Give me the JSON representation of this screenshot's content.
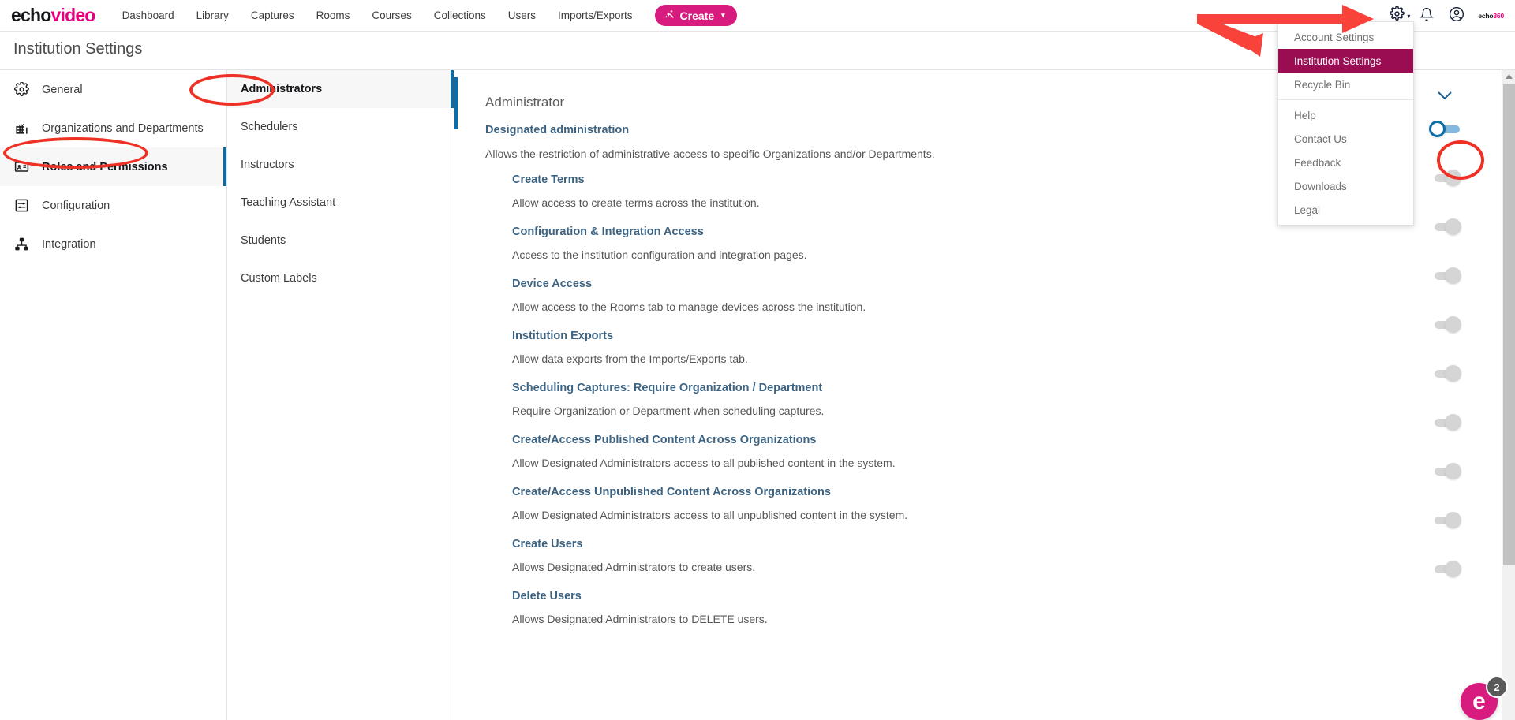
{
  "topnav": {
    "brand": {
      "part1": "echo",
      "part2": "video"
    },
    "links": [
      {
        "label": "Dashboard"
      },
      {
        "label": "Library"
      },
      {
        "label": "Captures"
      },
      {
        "label": "Rooms"
      },
      {
        "label": "Courses"
      },
      {
        "label": "Collections"
      },
      {
        "label": "Users"
      },
      {
        "label": "Imports/Exports"
      }
    ],
    "create_label": "Create",
    "create_caret": "▾",
    "wand_icon": "✨",
    "gear_caret": "▾",
    "logo_right": {
      "part1": "echo",
      "part2": "360"
    }
  },
  "settings_menu": {
    "items": [
      {
        "label": "Account Settings",
        "selected": false,
        "separator_after": false
      },
      {
        "label": "Institution Settings",
        "selected": true,
        "separator_after": false
      },
      {
        "label": "Recycle Bin",
        "selected": false,
        "separator_after": true
      },
      {
        "label": "Help",
        "selected": false,
        "separator_after": false
      },
      {
        "label": "Contact Us",
        "selected": false,
        "separator_after": false
      },
      {
        "label": "Feedback",
        "selected": false,
        "separator_after": false
      },
      {
        "label": "Downloads",
        "selected": false,
        "separator_after": false
      },
      {
        "label": "Legal",
        "selected": false,
        "separator_after": false
      }
    ]
  },
  "page": {
    "title": "Institution Settings"
  },
  "sidebar": {
    "items": [
      {
        "label": "General",
        "icon": "gear-icon",
        "active": false
      },
      {
        "label": "Organizations and Departments",
        "icon": "building-icon",
        "active": false
      },
      {
        "label": "Roles and Permissions",
        "icon": "id-card-icon",
        "active": true
      },
      {
        "label": "Configuration",
        "icon": "sliders-icon",
        "active": false
      },
      {
        "label": "Integration",
        "icon": "sitemap-icon",
        "active": false
      }
    ]
  },
  "subnav": {
    "items": [
      {
        "label": "Administrators",
        "active": true
      },
      {
        "label": "Schedulers",
        "active": false
      },
      {
        "label": "Instructors",
        "active": false
      },
      {
        "label": "Teaching Assistant",
        "active": false
      },
      {
        "label": "Students",
        "active": false
      },
      {
        "label": "Custom Labels",
        "active": false
      }
    ]
  },
  "main": {
    "heading": "Administrator",
    "top_permission": {
      "title": "Designated administration",
      "description": "Allows the restriction of administrative access to specific Organizations and/or Departments.",
      "toggle": "on"
    },
    "collapse_chevron": "⌄",
    "permissions": [
      {
        "title": "Create Terms",
        "description": "Allow access to create terms across the institution.",
        "toggle": "off"
      },
      {
        "title": "Configuration & Integration Access",
        "description": "Access to the institution configuration and integration pages.",
        "toggle": "off"
      },
      {
        "title": "Device Access",
        "description": "Allow access to the Rooms tab to manage devices across the institution.",
        "toggle": "off"
      },
      {
        "title": "Institution Exports",
        "description": "Allow data exports from the Imports/Exports tab.",
        "toggle": "off"
      },
      {
        "title": "Scheduling Captures: Require Organization / Department",
        "description": "Require Organization or Department when scheduling captures.",
        "toggle": "off"
      },
      {
        "title": "Create/Access Published Content Across Organizations",
        "description": "Allow Designated Administrators access to all published content in the system.",
        "toggle": "off"
      },
      {
        "title": "Create/Access Unpublished Content Across Organizations",
        "description": "Allow Designated Administrators access to all unpublished content in the system.",
        "toggle": "off"
      },
      {
        "title": "Create Users",
        "description": "Allows Designated Administrators to create users.",
        "toggle": "off"
      },
      {
        "title": "Delete Users",
        "description": "Allows Designated Administrators to DELETE users.",
        "toggle": "off"
      }
    ]
  },
  "help_widget": {
    "letter": "e",
    "badge_count": "2"
  },
  "colors": {
    "brand_pink": "#e6007e",
    "create_button": "#d81b7e",
    "menu_selected": "#9b0d53",
    "accent_blue": "#0b6ca8",
    "heading_blue": "#3c6382",
    "annotation_red": "#ee3124"
  }
}
